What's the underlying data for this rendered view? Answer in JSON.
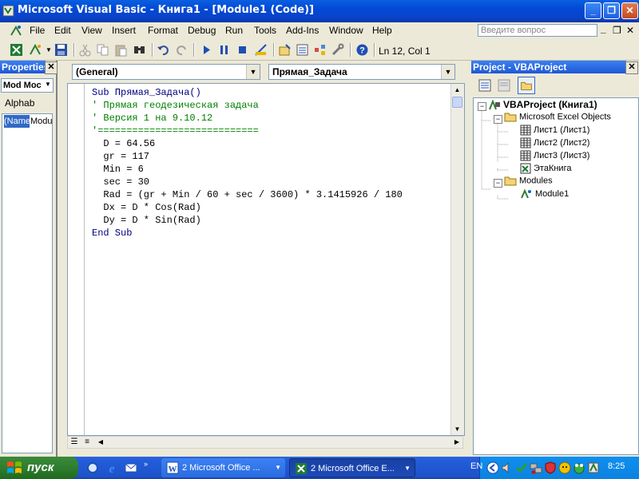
{
  "window": {
    "title": "Microsoft Visual Basic - Книга1 - [Module1 (Code)]",
    "min": "_",
    "restore": "❐",
    "close": "✕"
  },
  "menu": [
    "File",
    "Edit",
    "View",
    "Insert",
    "Format",
    "Debug",
    "Run",
    "Tools",
    "Add-Ins",
    "Window",
    "Help"
  ],
  "ask_placeholder": "Введите вопрос",
  "mdi": {
    "min": "_",
    "restore": "❐",
    "close": "✕"
  },
  "toolbar": {
    "position": "Ln 12, Col 1"
  },
  "properties": {
    "title": "Properties",
    "object_combo": "Mod Moc",
    "tab_alpha": "Alphab",
    "row_name": "(Name",
    "row_value": "Modu"
  },
  "code": {
    "object_combo": "(General)",
    "proc_combo": "Прямая_Задача",
    "lines": [
      {
        "t": "Sub Прямая_Задача()",
        "c": "kw"
      },
      {
        "t": "' Прямая геодезическая задача",
        "c": "cm"
      },
      {
        "t": "' Версия 1 на 9.10.12",
        "c": "cm"
      },
      {
        "t": "'============================",
        "c": "cm"
      },
      {
        "t": "  D = 64.56",
        "c": ""
      },
      {
        "t": "  gr = 117",
        "c": ""
      },
      {
        "t": "  Min = 6",
        "c": ""
      },
      {
        "t": "  sec = 30",
        "c": ""
      },
      {
        "t": "  Rad = (gr + Min / 60 + sec / 3600) * 3.1415926 / 180",
        "c": ""
      },
      {
        "t": "  Dx = D * Cos(Rad)",
        "c": ""
      },
      {
        "t": "  Dy = D * Sin(Rad)",
        "c": ""
      },
      {
        "t": "End Sub",
        "c": "kw"
      }
    ]
  },
  "project": {
    "title": "Project - VBAProject",
    "root": "VBAProject (Книга1)",
    "excel_objects": "Microsoft Excel Objects",
    "sheet1": "Лист1 (Лист1)",
    "sheet2": "Лист2 (Лист2)",
    "sheet3": "Лист3 (Лист3)",
    "workbook": "ЭтаКнига",
    "modules": "Modules",
    "module1": "Module1"
  },
  "taskbar": {
    "start": "пуск",
    "task1": "2 Microsoft Office ...",
    "task2": "2 Microsoft Office E...",
    "lang": "EN",
    "clock": "8:25"
  },
  "colors": {
    "accent": "#0A43C9",
    "comment": "#008000",
    "keyword": "#000080"
  }
}
